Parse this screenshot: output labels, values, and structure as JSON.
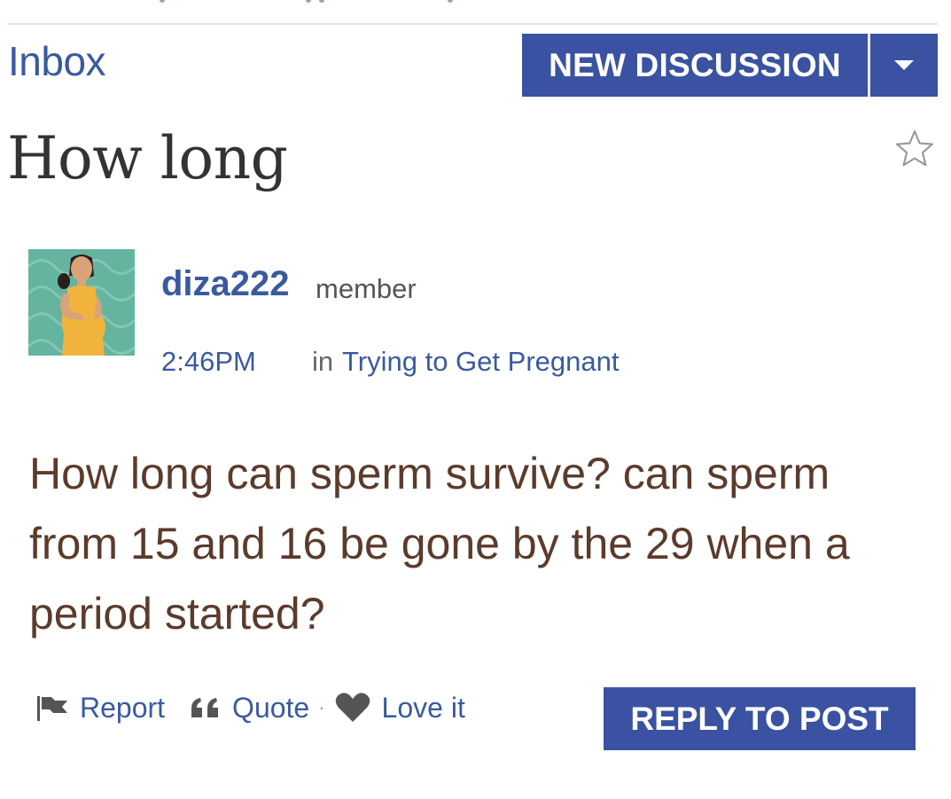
{
  "nav": {
    "inbox_label": "Inbox"
  },
  "toolbar": {
    "new_discussion_label": "NEW DISCUSSION"
  },
  "post": {
    "title": "How long",
    "author": {
      "username": "diza222",
      "role": "member"
    },
    "time": "2:46PM",
    "in_label": "in",
    "group": "Trying to Get Pregnant",
    "body": "How long can sperm survive? can sperm from 15 and 16 be gone by the 29 when a period started?"
  },
  "actions": {
    "report_label": "Report",
    "quote_label": "Quote",
    "separator": "·",
    "love_label": "Love it",
    "reply_label": "REPLY TO POST"
  },
  "colors": {
    "brand_blue": "#3a52a1",
    "link_blue": "#3a5aa0",
    "body_text": "#5b3b2b",
    "title_text": "#333333"
  },
  "icons": [
    "star-outline-icon",
    "chevron-down-icon",
    "flag-icon",
    "quote-icon",
    "heart-icon",
    "avatar-pregnant-woman"
  ]
}
